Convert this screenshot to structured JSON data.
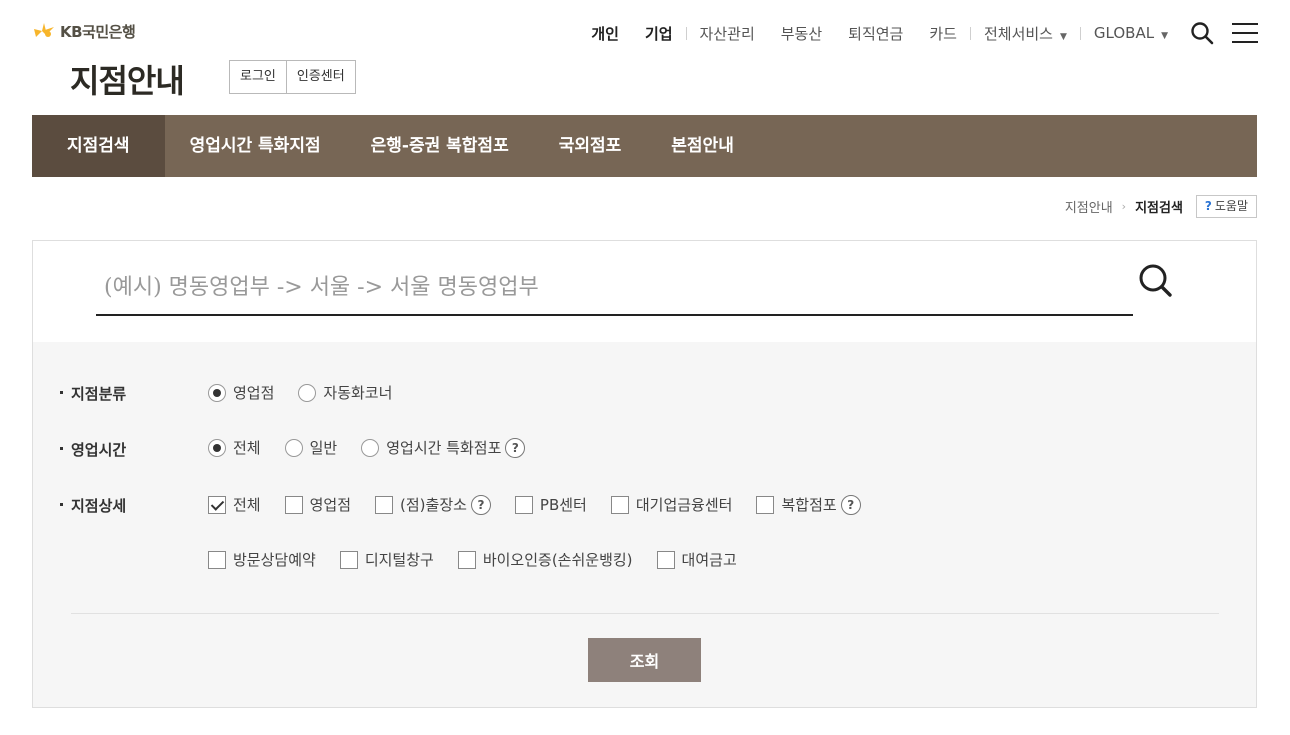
{
  "brand": {
    "logo_text": "KB국민은행"
  },
  "header": {
    "page_title": "지점안내",
    "login_label": "로그인",
    "cert_label": "인증센터"
  },
  "gnb": {
    "personal": "개인",
    "business": "기업",
    "asset": "자산관리",
    "realestate": "부동산",
    "pension": "퇴직연금",
    "card": "카드",
    "all_services": "전체서비스",
    "global": "GLOBAL"
  },
  "tabs": [
    {
      "label": "지점검색"
    },
    {
      "label": "영업시간 특화지점"
    },
    {
      "label": "은행-증권 복합점포"
    },
    {
      "label": "국외점포"
    },
    {
      "label": "본점안내"
    }
  ],
  "breadcrumb": {
    "parent": "지점안내",
    "current": "지점검색",
    "help_label": "도움말",
    "help_mark": "?"
  },
  "search": {
    "placeholder": "(예시) 명동영업부 -> 서울 -> 서울 명동영업부",
    "value": ""
  },
  "filters": {
    "branch_type": {
      "label": "지점분류",
      "options": [
        "영업점",
        "자동화코너"
      ],
      "selected": "영업점"
    },
    "hours": {
      "label": "영업시간",
      "options": [
        "전체",
        "일반",
        "영업시간 특화점포"
      ],
      "selected": "전체"
    },
    "detail": {
      "label": "지점상세",
      "options_row1": [
        "전체",
        "영업점",
        "(점)출장소",
        "PB센터",
        "대기업금융센터",
        "복합점포"
      ],
      "options_row2": [
        "방문상담예약",
        "디지털창구",
        "바이오인증(손쉬운뱅킹)",
        "대여금고"
      ],
      "checked": [
        "전체"
      ]
    },
    "help_mark": "?"
  },
  "query_button": "조회",
  "colors": {
    "tabbar": "#776655",
    "tab_active": "#5b4c3f",
    "query_button": "#8e817b",
    "logo_star": "#f7b52b"
  }
}
